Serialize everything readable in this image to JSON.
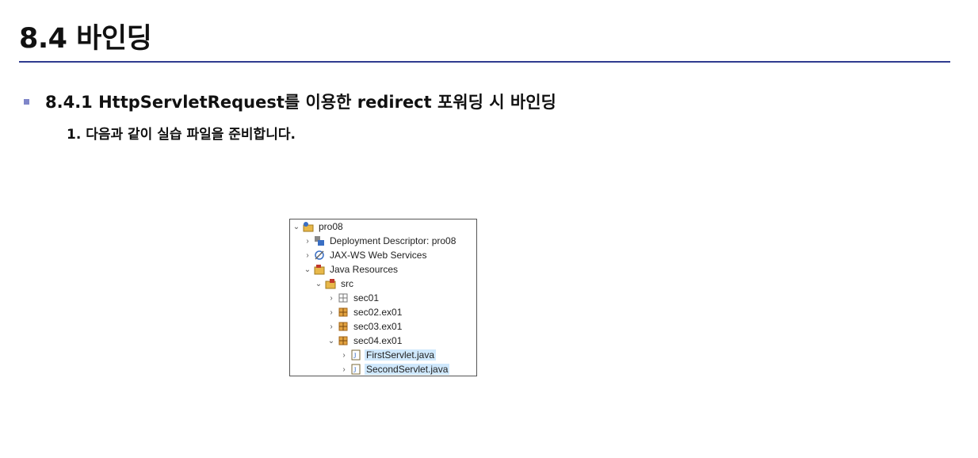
{
  "slide": {
    "title": "8.4 바인딩",
    "subtitle": "8.4.1 HttpServletRequest를 이용한 redirect 포워딩 시 바인딩",
    "step": "1. 다음과 같이 실습 파일을 준비합니다."
  },
  "tree": {
    "items": [
      {
        "label": "pro08",
        "chevron": "⌄",
        "icon": "project-icon"
      },
      {
        "label": "Deployment Descriptor: pro08",
        "chevron": "›",
        "icon": "descriptor-icon"
      },
      {
        "label": "JAX-WS Web Services",
        "chevron": "›",
        "icon": "webservices-icon"
      },
      {
        "label": "Java Resources",
        "chevron": "⌄",
        "icon": "java-resources-icon"
      },
      {
        "label": "src",
        "chevron": "⌄",
        "icon": "source-folder-icon"
      },
      {
        "label": "sec01",
        "chevron": "›",
        "icon": "empty-package-icon"
      },
      {
        "label": "sec02.ex01",
        "chevron": "›",
        "icon": "package-icon"
      },
      {
        "label": "sec03.ex01",
        "chevron": "›",
        "icon": "package-icon"
      },
      {
        "label": "sec04.ex01",
        "chevron": "⌄",
        "icon": "package-icon"
      },
      {
        "label": "FirstServlet.java",
        "chevron": "›",
        "icon": "java-file-icon"
      },
      {
        "label": "SecondServlet.java",
        "chevron": "›",
        "icon": "java-file-icon"
      }
    ]
  },
  "colors": {
    "rule": "#2f3b8f",
    "bullet": "#7f86c9",
    "selection": "#cfe8fc"
  }
}
